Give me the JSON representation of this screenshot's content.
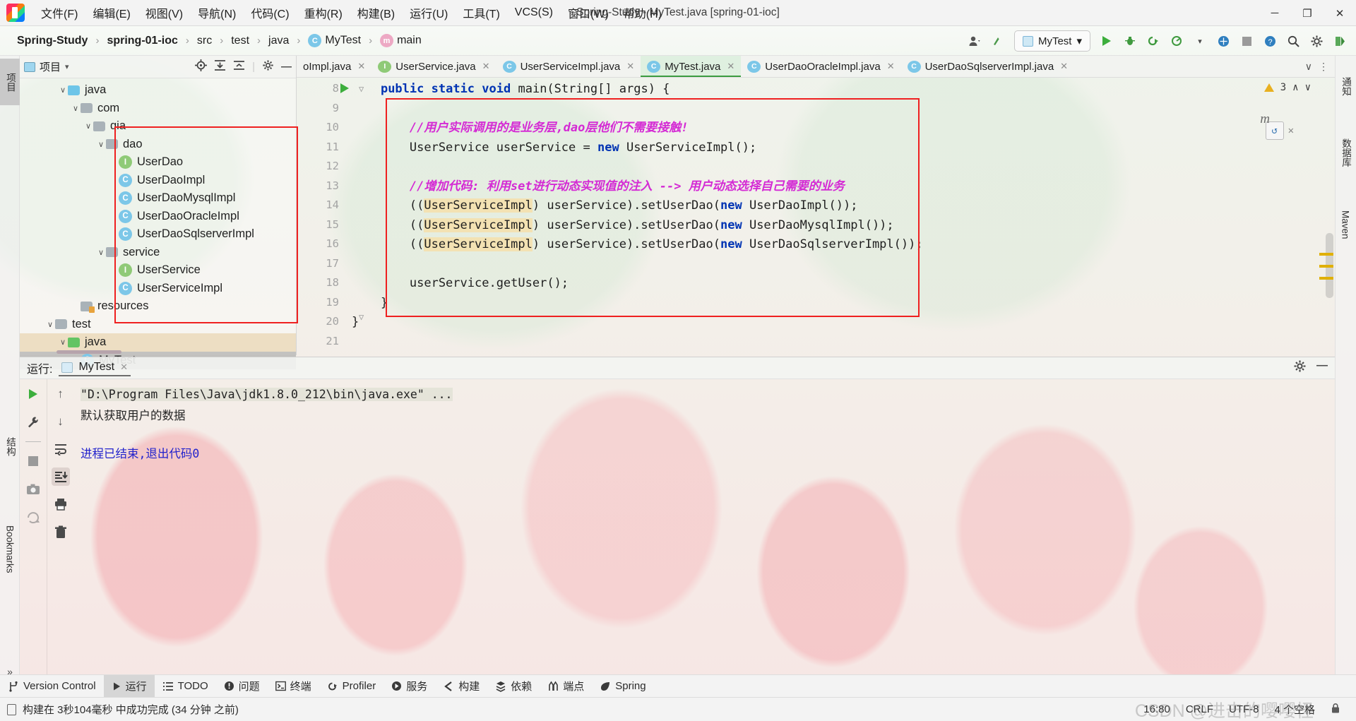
{
  "window": {
    "title": "Spring-Study - MyTest.java [spring-01-ioc]",
    "minimize": "─",
    "maximize": "❐",
    "close": "✕"
  },
  "menubar": {
    "items": [
      "文件(F)",
      "编辑(E)",
      "视图(V)",
      "导航(N)",
      "代码(C)",
      "重构(R)",
      "构建(B)",
      "运行(U)",
      "工具(T)",
      "VCS(S)",
      "窗口(W)",
      "帮助(H)"
    ]
  },
  "breadcrumb": {
    "items": [
      {
        "label": "Spring-Study",
        "bold": true,
        "icon": ""
      },
      {
        "label": "spring-01-ioc",
        "bold": true,
        "icon": ""
      },
      {
        "label": "src",
        "bold": false,
        "icon": ""
      },
      {
        "label": "test",
        "bold": false,
        "icon": ""
      },
      {
        "label": "java",
        "bold": false,
        "icon": ""
      },
      {
        "label": "MyTest",
        "bold": false,
        "icon": "class-icon",
        "glyph": "C"
      },
      {
        "label": "main",
        "bold": false,
        "icon": "method-icon",
        "glyph": "m"
      }
    ],
    "separator": "›"
  },
  "toolbar": {
    "account_icon": "account-icon",
    "updates_icon": "update-arrow-icon",
    "run_config": "MyTest",
    "run_icon": "run-icon",
    "debug_icon": "debug-icon",
    "run_coverage_icon": "run-with-coverage-icon",
    "profiler_icon": "profiler-icon",
    "stop_icon": "stop-icon",
    "help_icon": "help-icon",
    "search_icon": "search-icon",
    "settings_icon": "gear-icon",
    "ide_icon": "ide-services-icon",
    "dropdown_caret": "▾"
  },
  "left_rail": {
    "items": [
      {
        "label": "项目",
        "icon": "project-icon",
        "active": true
      },
      {
        "label": "结构",
        "icon": "structure-icon",
        "active": false
      },
      {
        "label": "Bookmarks",
        "icon": "bookmark-icon",
        "active": false
      }
    ],
    "more": "»"
  },
  "right_rail": {
    "items": [
      {
        "label": "通知",
        "icon": "bell-icon"
      },
      {
        "label": "数据库",
        "icon": "database-icon"
      },
      {
        "label": "Maven",
        "icon": "maven-icon"
      }
    ]
  },
  "project_panel": {
    "title": "项目",
    "caret": "▾",
    "icons": [
      "locate-icon",
      "expand-all-icon",
      "collapse-all-icon",
      "gear-icon",
      "hide-icon"
    ],
    "tree": [
      {
        "label": "java",
        "indent": 3,
        "type": "folder-blue",
        "chevron": "∨"
      },
      {
        "label": "com",
        "indent": 4,
        "type": "folder-grey",
        "chevron": "∨"
      },
      {
        "label": "qia",
        "indent": 5,
        "type": "folder-grey",
        "chevron": "∨"
      },
      {
        "label": "dao",
        "indent": 6,
        "type": "folder-grey",
        "chevron": "∨"
      },
      {
        "label": "UserDao",
        "indent": 7,
        "type": "interface",
        "chevron": ""
      },
      {
        "label": "UserDaoImpl",
        "indent": 7,
        "type": "class",
        "chevron": ""
      },
      {
        "label": "UserDaoMysqlImpl",
        "indent": 7,
        "type": "class",
        "chevron": ""
      },
      {
        "label": "UserDaoOracleImpl",
        "indent": 7,
        "type": "class",
        "chevron": ""
      },
      {
        "label": "UserDaoSqlserverImpl",
        "indent": 7,
        "type": "class",
        "chevron": ""
      },
      {
        "label": "service",
        "indent": 6,
        "type": "folder-grey",
        "chevron": "∨"
      },
      {
        "label": "UserService",
        "indent": 7,
        "type": "interface",
        "chevron": ""
      },
      {
        "label": "UserServiceImpl",
        "indent": 7,
        "type": "class",
        "chevron": ""
      },
      {
        "label": "resources",
        "indent": 4,
        "type": "folder-res",
        "chevron": ""
      },
      {
        "label": "test",
        "indent": 2,
        "type": "folder-grey",
        "chevron": "∨"
      },
      {
        "label": "java",
        "indent": 3,
        "type": "folder-green",
        "chevron": "∨",
        "selected": "java"
      },
      {
        "label": "MyTest",
        "indent": 4,
        "type": "class",
        "chevron": "",
        "selected": "mytest"
      }
    ]
  },
  "editor": {
    "tabs": [
      {
        "label": "oImpl.java",
        "icon": "",
        "active": false,
        "clipped": true
      },
      {
        "label": "UserService.java",
        "icon": "I",
        "active": false
      },
      {
        "label": "UserServiceImpl.java",
        "icon": "C",
        "active": false
      },
      {
        "label": "MyTest.java",
        "icon": "C",
        "active": true
      },
      {
        "label": "UserDaoOracleImpl.java",
        "icon": "C",
        "active": false
      },
      {
        "label": "UserDaoSqlserverImpl.java",
        "icon": "C",
        "active": false
      }
    ],
    "tab_close": "✕",
    "tabs_right_icons": [
      "∨",
      "⋮"
    ],
    "warning_count": "3",
    "warning_icon": "warning-triangle-icon",
    "nav_up": "∧",
    "nav_down": "∨",
    "line_numbers": [
      "8",
      "9",
      "10",
      "11",
      "12",
      "13",
      "14",
      "15",
      "16",
      "17",
      "18",
      "19",
      "20",
      "21"
    ],
    "code_lines": [
      {
        "n": 8,
        "segments": [
          {
            "t": "    ",
            "c": ""
          },
          {
            "t": "public",
            "c": "k"
          },
          {
            "t": " ",
            "c": ""
          },
          {
            "t": "static",
            "c": "k"
          },
          {
            "t": " ",
            "c": ""
          },
          {
            "t": "void",
            "c": "k"
          },
          {
            "t": " main(String[] args) {",
            "c": ""
          }
        ]
      },
      {
        "n": 9,
        "segments": []
      },
      {
        "n": 10,
        "segments": [
          {
            "t": "        ",
            "c": ""
          },
          {
            "t": "//用户实际调用的是业务层,dao层他们不需要接触!",
            "c": "cm"
          }
        ]
      },
      {
        "n": 11,
        "segments": [
          {
            "t": "        UserService userService = ",
            "c": ""
          },
          {
            "t": "new",
            "c": "k"
          },
          {
            "t": " UserServiceImpl();",
            "c": ""
          }
        ]
      },
      {
        "n": 12,
        "segments": []
      },
      {
        "n": 13,
        "segments": [
          {
            "t": "        ",
            "c": ""
          },
          {
            "t": "//增加代码: 利用set进行动态实现值的注入 --> 用户动态选择自己需要的业务",
            "c": "cm"
          }
        ]
      },
      {
        "n": 14,
        "segments": [
          {
            "t": "        ((",
            "c": ""
          },
          {
            "t": "UserServiceImpl",
            "c": "hl"
          },
          {
            "t": ") userService).setUserDao(",
            "c": ""
          },
          {
            "t": "new",
            "c": "k"
          },
          {
            "t": " UserDaoImpl());",
            "c": ""
          }
        ]
      },
      {
        "n": 15,
        "segments": [
          {
            "t": "        ((",
            "c": ""
          },
          {
            "t": "UserServiceImpl",
            "c": "hl"
          },
          {
            "t": ") userService).setUserDao(",
            "c": ""
          },
          {
            "t": "new",
            "c": "k"
          },
          {
            "t": " UserDaoMysqlImpl());",
            "c": ""
          }
        ]
      },
      {
        "n": 16,
        "segments": [
          {
            "t": "        ((",
            "c": ""
          },
          {
            "t": "UserServiceImpl",
            "c": "hl"
          },
          {
            "t": ") userService).setUserDao(",
            "c": ""
          },
          {
            "t": "new",
            "c": "k"
          },
          {
            "t": " UserDaoSqlserverImpl());",
            "c": ""
          }
        ]
      },
      {
        "n": 17,
        "segments": []
      },
      {
        "n": 18,
        "segments": [
          {
            "t": "        userService.getUser();",
            "c": ""
          }
        ]
      },
      {
        "n": 19,
        "segments": [
          {
            "t": "    }",
            "c": ""
          }
        ]
      },
      {
        "n": 20,
        "segments": [
          {
            "t": "}",
            "c": ""
          }
        ]
      },
      {
        "n": 21,
        "segments": []
      }
    ]
  },
  "run_panel": {
    "label": "运行:",
    "tab_name": "MyTest",
    "tab_close": "✕",
    "gear_icon": "gear-icon",
    "hide_icon": "hide-icon",
    "left_tools": [
      "run-icon",
      "wrench-icon",
      "stop-icon",
      "camera-icon",
      "rerun-failed-icon"
    ],
    "right_tools": [
      "arrow-up-icon",
      "arrow-down-icon",
      "soft-wrap-icon",
      "scroll-to-end-icon",
      "print-icon",
      "trash-icon"
    ],
    "console": [
      {
        "text": "\"D:\\Program Files\\Java\\jdk1.8.0_212\\bin\\java.exe\" ...",
        "style": "cmd"
      },
      {
        "text": "默认获取用户的数据",
        "style": "out"
      },
      {
        "text": "进程已结束,退出代码0",
        "style": "exit"
      }
    ]
  },
  "bottom_bar": {
    "items": [
      {
        "label": "Version Control",
        "icon": "branch-icon",
        "active": false
      },
      {
        "label": "运行",
        "icon": "run-icon",
        "active": true
      },
      {
        "label": "TODO",
        "icon": "todo-icon",
        "active": false
      },
      {
        "label": "问题",
        "icon": "problems-icon",
        "active": false
      },
      {
        "label": "终端",
        "icon": "terminal-icon",
        "active": false
      },
      {
        "label": "Profiler",
        "icon": "profiler-icon",
        "active": false
      },
      {
        "label": "服务",
        "icon": "services-icon",
        "active": false
      },
      {
        "label": "构建",
        "icon": "build-icon",
        "active": false
      },
      {
        "label": "依赖",
        "icon": "dependencies-icon",
        "active": false
      },
      {
        "label": "端点",
        "icon": "endpoints-icon",
        "active": false
      },
      {
        "label": "Spring",
        "icon": "spring-leaf-icon",
        "active": false
      }
    ]
  },
  "status_bar": {
    "message": "构建在 3秒104毫秒 中成功完成 (34 分钟 之前)",
    "message_icon": "build-status-icon",
    "caret_position": "16:80",
    "line_separator": "CRLF",
    "encoding": "UTF-8",
    "indent": "4 个空格",
    "lock_icon": "lock-icon"
  },
  "watermark": "CSDN @进击的嘤嘤怪"
}
